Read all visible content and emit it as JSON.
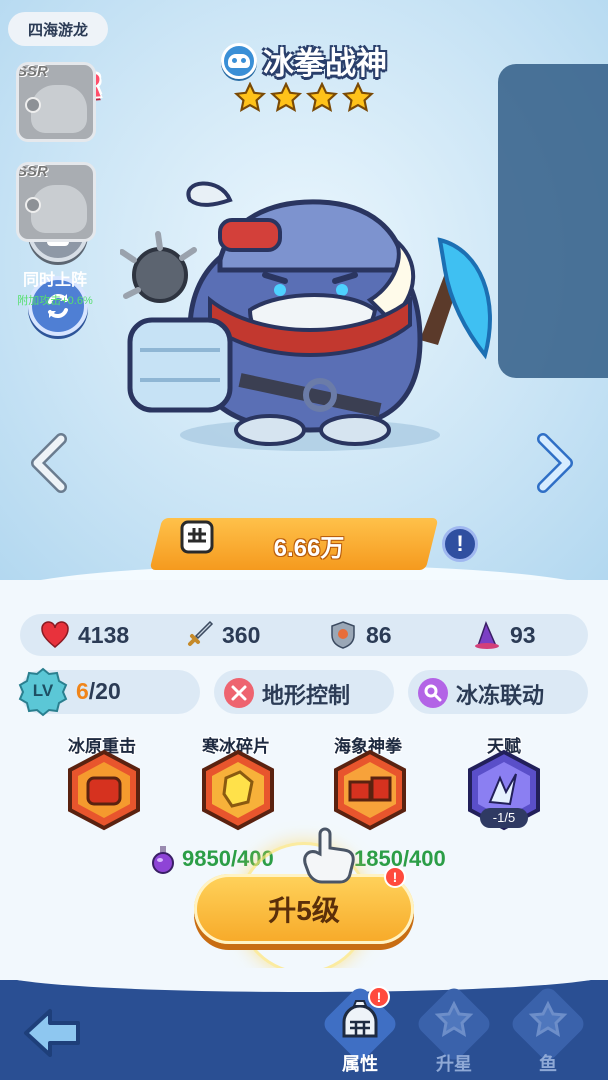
{
  "hero": {
    "rarity": "SSR",
    "name": "冰拳战神",
    "stars": 4,
    "power": "6.66万"
  },
  "team_panel": {
    "title": "四海游龙",
    "slots": [
      {
        "rarity": "SSR"
      },
      {
        "rarity": "SSR"
      }
    ],
    "subtitle": "同时上阵",
    "bonus": "附加攻击+0.6%"
  },
  "stats": {
    "hp": "4138",
    "attack": "360",
    "defense": "86",
    "speed": "93"
  },
  "level": {
    "badge": "LV",
    "current": "6",
    "max": "/20"
  },
  "tags": {
    "terrain": "地形控制",
    "freeze": "冰冻联动"
  },
  "skills": [
    {
      "name": "冰原重击"
    },
    {
      "name": "寒冰碎片"
    },
    {
      "name": "海象神拳"
    },
    {
      "name": "天赋",
      "count": "-1/5"
    }
  ],
  "costs": {
    "potion": "9850/400",
    "coins": "1850/400"
  },
  "upgrade": {
    "label": "升5级",
    "alert": "!"
  },
  "bottom_nav": {
    "tabs": [
      {
        "label": "属性",
        "active": true,
        "alert": "!"
      },
      {
        "label": "升星",
        "active": false
      },
      {
        "label": "鱼",
        "active": false
      }
    ]
  },
  "colors": {
    "accent_orange": "#f59a1e",
    "power_green": "#2c9e47",
    "nav_blue": "#2a4f93",
    "alert_red": "#ff4a3d"
  }
}
